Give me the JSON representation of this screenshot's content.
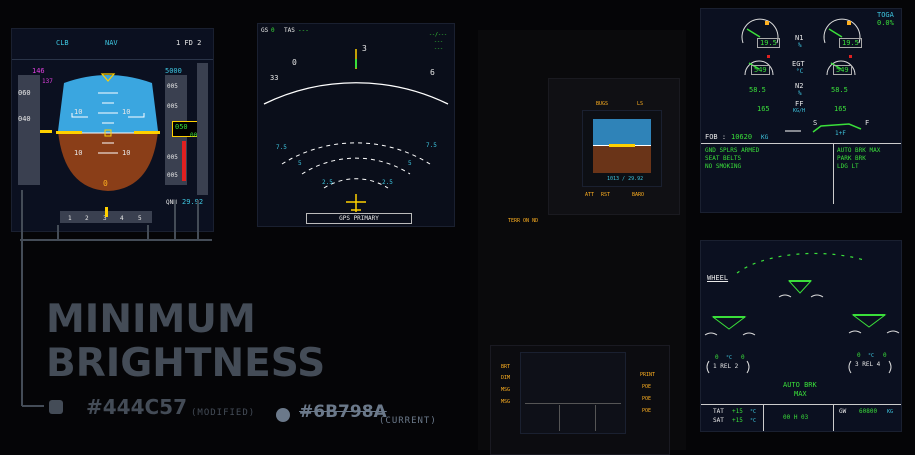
{
  "pfd": {
    "fma": [
      "CLB",
      "NAV",
      "1 FD 2"
    ],
    "speed_target": "146",
    "speed_marks": [
      "060",
      "040",
      "137"
    ],
    "alt_target": "5000",
    "alt_marks": [
      "005",
      "005",
      "005",
      "005"
    ],
    "alt_readout": "050",
    "alt_readout_small": "00",
    "pitch_marks": [
      "10",
      "10",
      "10",
      "10"
    ],
    "heading_marks": [
      "1",
      "2",
      "3",
      "4",
      "5"
    ],
    "baro_label": "QNH",
    "baro_value": "29.92",
    "attitude_zero": "0"
  },
  "nd": {
    "gs_label": "GS",
    "gs_value": "0",
    "tas_label": "TAS",
    "tas_value": "---",
    "right_top": [
      "--/---",
      "---",
      "---"
    ],
    "compass": [
      "33",
      "0",
      "3",
      "6"
    ],
    "range_labels": [
      "7.5",
      "7.5",
      "5",
      "5",
      "2.5",
      "2.5"
    ],
    "footer": "GPS PRIMARY"
  },
  "isis": {
    "top_left": "BUGS",
    "top_right": "LS",
    "bottom": [
      "ATT",
      "RST",
      "BARO"
    ],
    "readout": "1013 / 29.92"
  },
  "center": {
    "terr": "TERR ON ND"
  },
  "ewd": {
    "thrust_mode": "TOGA",
    "thrust_value": "0.0%",
    "n1_label": "N1",
    "pct": "%",
    "n1_left": "19.5",
    "n1_right": "19.5",
    "egt_label": "EGT",
    "egt_unit": "°C",
    "egt_left": "549",
    "egt_right": "549",
    "n2_label": "N2",
    "n2_left": "58.5",
    "n2_right": "58.5",
    "ff_label": "FF",
    "ff_unit": "KG/H",
    "ff_left": "165",
    "ff_right": "165",
    "slat": "S",
    "flap": "F",
    "flap_pos": "1+F",
    "fob_label": "FOB :",
    "fob_value": "10620",
    "fob_unit": "KG",
    "memo_left": [
      "GND SPLRS ARMED",
      "SEAT BELTS",
      "NO SMOKING"
    ],
    "memo_right": [
      "AUTO BRK MAX",
      "PARK BRK",
      "LDG LT"
    ]
  },
  "sd": {
    "title": "WHEEL",
    "rel_left": "1  REL  2",
    "rel_right": "3  REL  4",
    "brake_temp_left": [
      "0",
      "°C",
      "0"
    ],
    "brake_temp_right": [
      "0",
      "°C",
      "0"
    ],
    "auto_brk": "AUTO BRK",
    "auto_brk_mode": "MAX",
    "tat_label": "TAT",
    "tat_value": "+15",
    "sat_label": "SAT",
    "sat_value": "+15",
    "unit_c": "°C",
    "time": "00 H 03",
    "gw_label": "GW",
    "gw_value": "60800",
    "gw_unit": "KG"
  },
  "mcdu": {
    "left_keys": [
      "BRT",
      "DIM",
      "MSG",
      "MSG"
    ],
    "right_keys": [
      "PRINT",
      "POE",
      "POE",
      "POE"
    ]
  },
  "caption": {
    "line1": "MINIMUM",
    "line2": "BRIGHTNESS",
    "modified_hex": "#444C57",
    "modified_tag": "(MODIFIED)",
    "current_hex": "#6B798A",
    "current_tag": "(CURRENT)",
    "modified_color": "#444C57",
    "current_color": "#6B798A"
  }
}
